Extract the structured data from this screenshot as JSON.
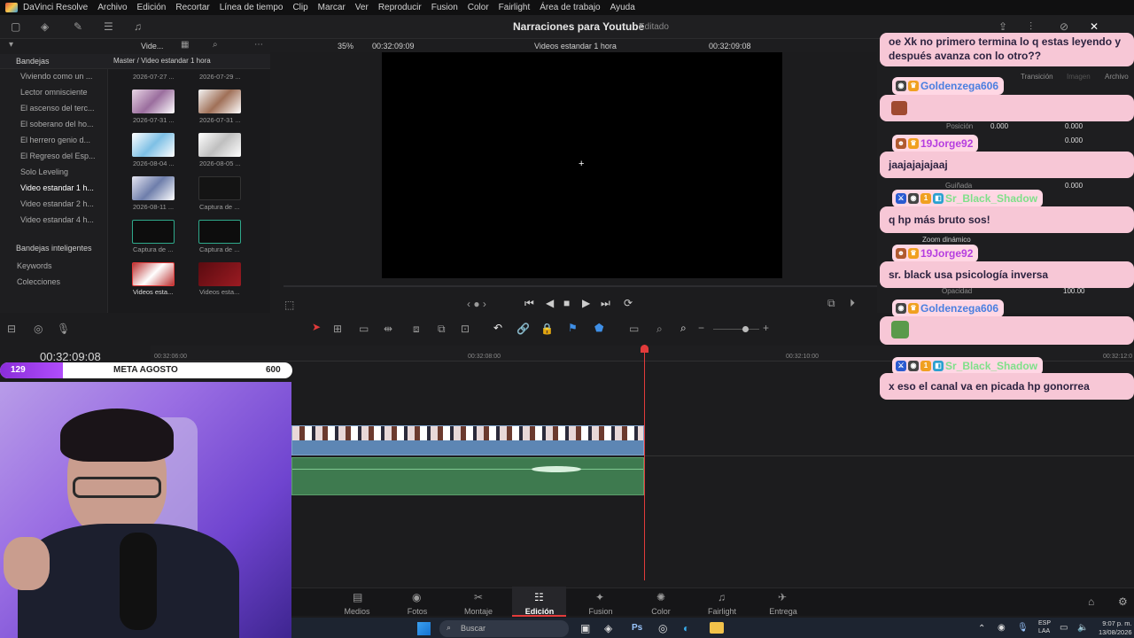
{
  "menu": [
    "DaVinci Resolve",
    "Archivo",
    "Edición",
    "Recortar",
    "Línea de tiempo",
    "Clip",
    "Marcar",
    "Ver",
    "Reproducir",
    "Fusion",
    "Color",
    "Fairlight",
    "Área de trabajo",
    "Ayuda"
  ],
  "project": {
    "title": "Narraciones para Youtube",
    "status": "Editado"
  },
  "toolbar": {
    "bin_short": "Vide...",
    "zoom": "35%",
    "tc_left": "00:32:09:09",
    "viewer_title": "Videos estandar 1 hora",
    "tc_right": "00:32:09:08"
  },
  "bins": {
    "header": "Bandejas",
    "path": "Master / Video estandar 1 hora",
    "items": [
      "Viviendo como un ...",
      "Lector omnisciente",
      "El ascenso del terc...",
      "El soberano del ho...",
      "El herrero genio d...",
      "El Regreso del Esp...",
      "Solo Leveling",
      "Video estandar 1 h...",
      "Video estandar 2 h...",
      "Video estandar 4 h..."
    ],
    "smart_header": "Bandejas inteligentes",
    "smart_items": [
      "Keywords",
      "Colecciones"
    ]
  },
  "clips": [
    {
      "label": "2026-07-27 ..."
    },
    {
      "label": "2026-07-29 ..."
    },
    {
      "label": "2026-07-31 ..."
    },
    {
      "label": "2026-07-31 ..."
    },
    {
      "label": "2026-08-04 ..."
    },
    {
      "label": "2026-08-05 ..."
    },
    {
      "label": "2026-08-11 ..."
    },
    {
      "label": "Captura de ..."
    },
    {
      "label": "Captura de ..."
    },
    {
      "label": "Captura de ..."
    },
    {
      "label": "Videos esta..."
    },
    {
      "label": "Videos esta..."
    }
  ],
  "timeline": {
    "timecode": "00:32:09:08",
    "ticks": [
      "00:32:06:00",
      "00:32:08:00",
      "00:32:10:00",
      "00:32:12:0"
    ]
  },
  "goal": {
    "current": "129",
    "label": "META AGOSTO",
    "target": "600",
    "progress": 0.215
  },
  "pages": [
    "Medios",
    "Fotos",
    "Montaje",
    "Edición",
    "Fusion",
    "Color",
    "Fairlight",
    "Entrega"
  ],
  "active_page": "Edición",
  "inspector": {
    "tabs": [
      "Transición",
      "Imagen",
      "Archivo"
    ],
    "fields": [
      {
        "label": "Posición",
        "x": "0.000",
        "y": "0.000"
      },
      {
        "label": "",
        "value": "0.000"
      },
      {
        "label": "Guiñada",
        "value": "0.000"
      },
      {
        "label": "Zoom dinámico",
        "value": ""
      },
      {
        "label": "Opacidad",
        "value": "100.00"
      }
    ]
  },
  "chat": [
    {
      "user": "",
      "text": "oe Xk no primero termina lo q estas leyendo y después avanza con lo otro??"
    },
    {
      "user": "Goldenzega606",
      "text": ""
    },
    {
      "user": "19Jorge92",
      "text": "jaajajajajaaj"
    },
    {
      "user": "Sr_Black_Shadow",
      "text": "q hp más bruto sos!"
    },
    {
      "user": "19Jorge92",
      "text": "sr. black usa psicología inversa"
    },
    {
      "user": "Goldenzega606",
      "text": ""
    },
    {
      "user": "Sr_Black_Shadow",
      "text": "x eso el canal va en picada hp gonorrea"
    }
  ],
  "taskbar": {
    "search": "Buscar",
    "lang": "ESP",
    "region": "LAA",
    "time": "9:07 p. m.",
    "date": "13/08/2026"
  },
  "colors": {
    "accent": "#e23b3b",
    "chat_bg": "#f7c7d6",
    "goal_fill": "#9b3df0",
    "video_clip": "#5d86b4",
    "audio_clip": "#3e7a4f"
  }
}
